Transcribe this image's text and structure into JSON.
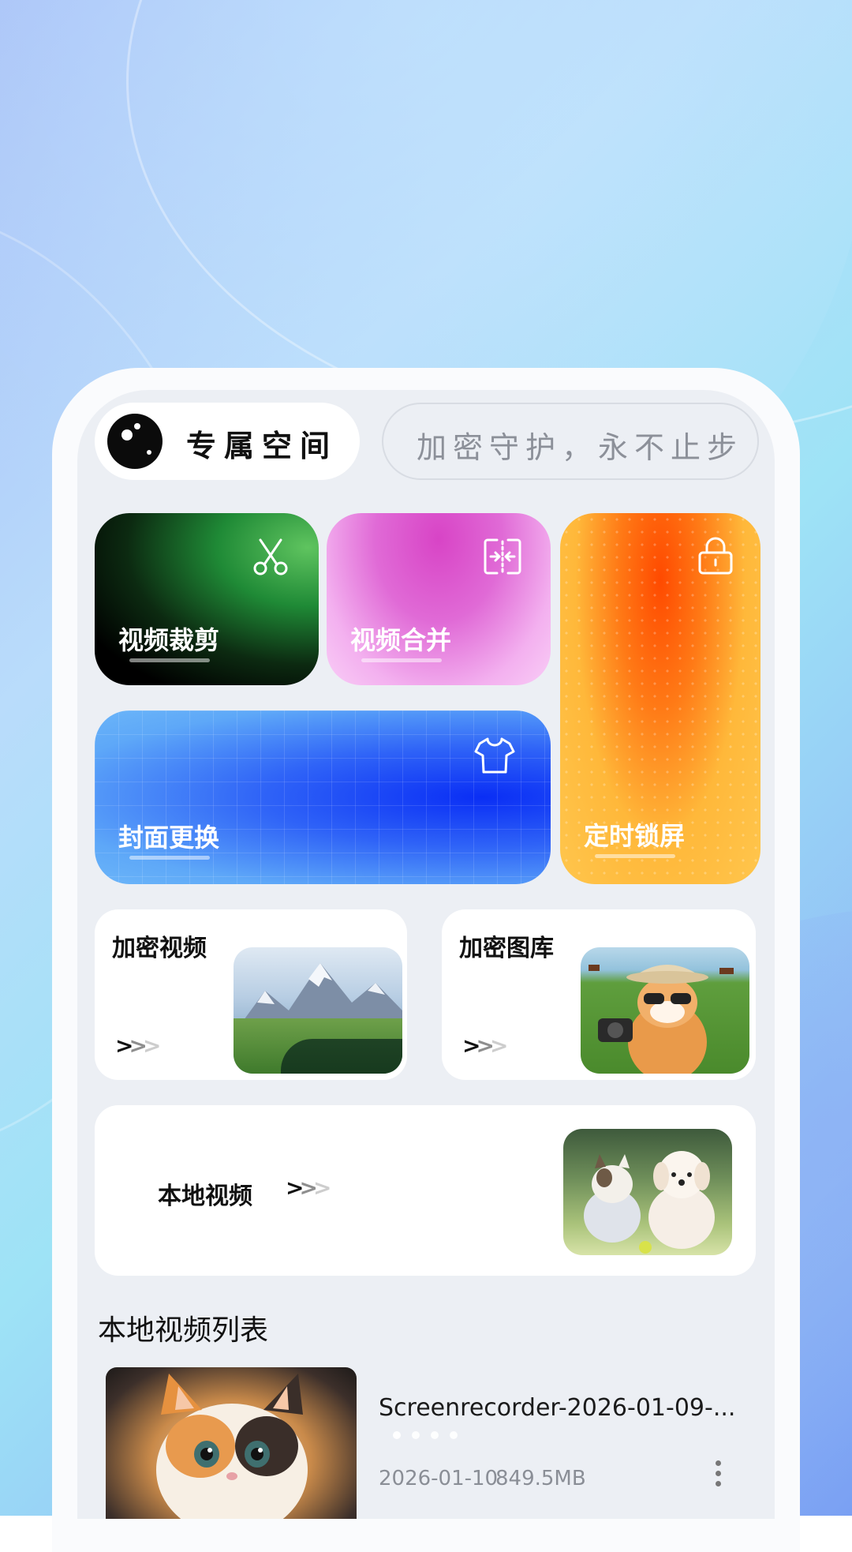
{
  "header": {
    "brand_title": "专属空间",
    "slogan": "加密守护，永不止步"
  },
  "features": {
    "crop": {
      "label": "视频裁剪",
      "icon": "scissors-icon"
    },
    "merge": {
      "label": "视频合并",
      "icon": "merge-icon"
    },
    "lock": {
      "label": "定时锁屏",
      "icon": "lock-icon"
    },
    "cover": {
      "label": "封面更换",
      "icon": "tshirt-icon"
    }
  },
  "cards": {
    "encrypted_video": {
      "title": "加密视频",
      "arrow": ">>>"
    },
    "encrypted_gallery": {
      "title": "加密图库",
      "arrow": ">>>"
    },
    "local_video": {
      "title": "本地视频",
      "arrow": ">>>"
    }
  },
  "list": {
    "section_title": "本地视频列表",
    "items": [
      {
        "name": "Screenrecorder-2026-01-09-...",
        "date": "2026-01-10",
        "size": "849.5MB"
      }
    ]
  },
  "colors": {
    "screen_bg": "#eceff4",
    "crop_accent": "#5fc45f",
    "merge_accent": "#d844c6",
    "lock_accent": "#ff4a00",
    "cover_accent": "#0a2ef5"
  }
}
